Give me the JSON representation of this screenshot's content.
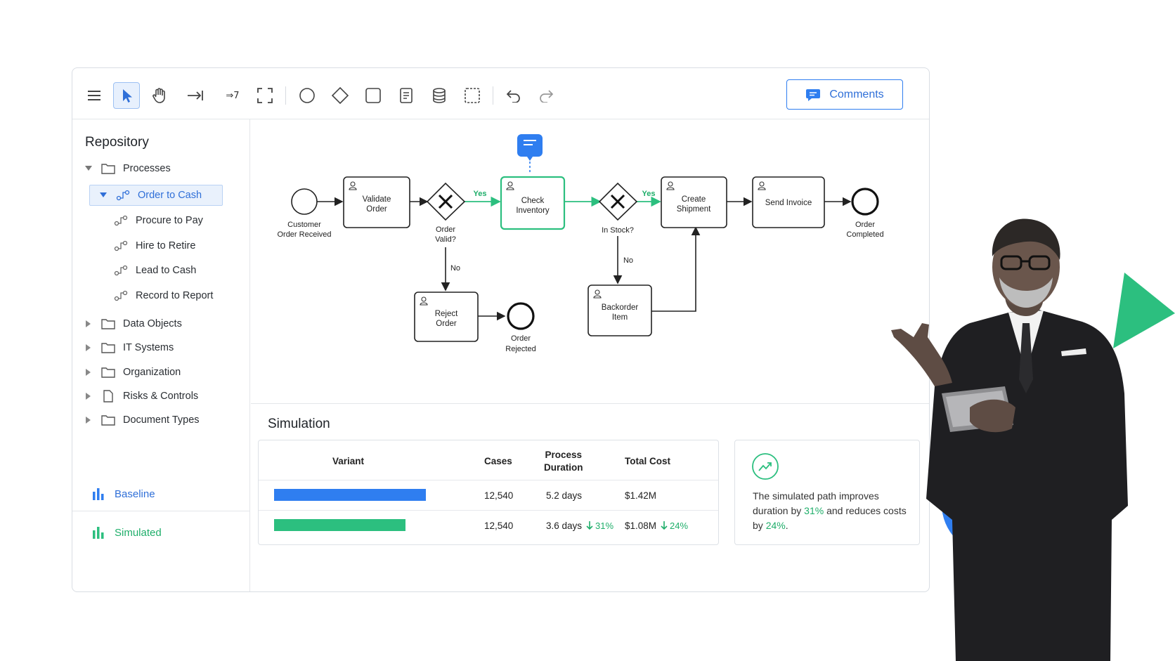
{
  "toolbar": {
    "tools": [
      "menu-icon",
      "pointer-icon",
      "hand-icon",
      "connect-icon",
      "flow-icon",
      "frame-icon",
      "circle-icon",
      "diamond-icon",
      "square-icon",
      "document-icon",
      "database-icon",
      "group-icon",
      "undo-icon",
      "redo-icon"
    ],
    "flow_tool_label": "⇒7",
    "comments_label": "Comments"
  },
  "sidebar": {
    "title": "Repository",
    "folders_top": "Processes",
    "processes": [
      {
        "label": "Order to Cash",
        "selected": true
      },
      {
        "label": "Procure to Pay"
      },
      {
        "label": "Hire to Retire"
      },
      {
        "label": "Lead to Cash"
      },
      {
        "label": "Record to Report"
      }
    ],
    "folders": [
      "Data Objects",
      "IT Systems",
      "Organization",
      "Risks & Controls",
      "Document Types"
    ],
    "legend": [
      {
        "label": "Baseline",
        "color": "#2f7ef0"
      },
      {
        "label": "Simulated",
        "color": "#2cbf7f"
      }
    ]
  },
  "diagram": {
    "start_label_1": "Customer",
    "start_label_2": "Order Received",
    "validate_1": "Validate",
    "validate_2": "Order",
    "gw1_1": "Order",
    "gw1_2": "Valid?",
    "yes1": "Yes",
    "no1": "No",
    "check_1": "Check",
    "check_2": "Inventory",
    "gw2": "In Stock?",
    "yes2": "Yes",
    "no2": "No",
    "create_1": "Create",
    "create_2": "Shipment",
    "invoice": "Send Invoice",
    "end_1": "Order",
    "end_2": "Completed",
    "reject_1": "Reject",
    "reject_2": "Order",
    "rejected_1": "Order",
    "rejected_2": "Rejected",
    "backorder_1": "Backorder",
    "backorder_2": "Item"
  },
  "simulation": {
    "title": "Simulation",
    "headers": {
      "variant": "Variant",
      "cases": "Cases",
      "duration_1": "Process",
      "duration_2": "Duration",
      "cost": "Total Cost"
    },
    "rows": [
      {
        "cases": "12,540",
        "duration": "5.2 days",
        "cost": "$1.42M",
        "bar_fraction": 1.0,
        "color": "#2f7ef0"
      },
      {
        "cases": "12,540",
        "duration": "3.6 days",
        "duration_delta": "31%",
        "cost": "$1.08M",
        "cost_delta": "24%",
        "bar_fraction": 0.865,
        "color": "#2cbf7f"
      }
    ],
    "insight": {
      "text_1": "The simulated path improves duration by ",
      "pct_1": "31%",
      "text_2": " and reduces costs by ",
      "pct_2": "24%",
      "text_3": "."
    }
  },
  "colors": {
    "accent_blue": "#2f7ef0",
    "accent_green": "#2cbf7f"
  }
}
